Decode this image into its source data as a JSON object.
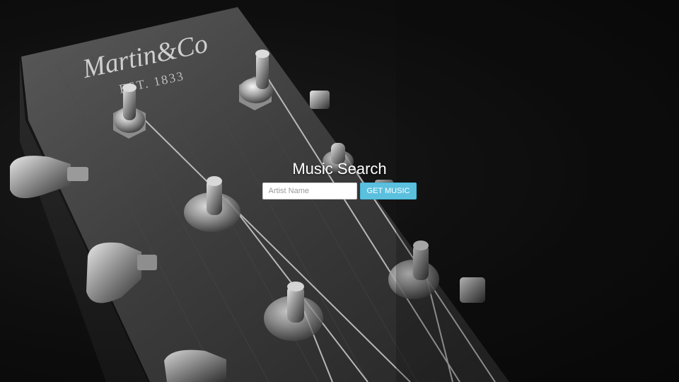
{
  "background": {
    "logo_text": "Martin&Co",
    "logo_subtext": "EST. 1833",
    "description_color": "#0b0b0b"
  },
  "search": {
    "title": "Music Search",
    "placeholder": "Artist Name",
    "value": "",
    "button_label": "GET MUSIC",
    "button_color": "#5bc0de"
  }
}
